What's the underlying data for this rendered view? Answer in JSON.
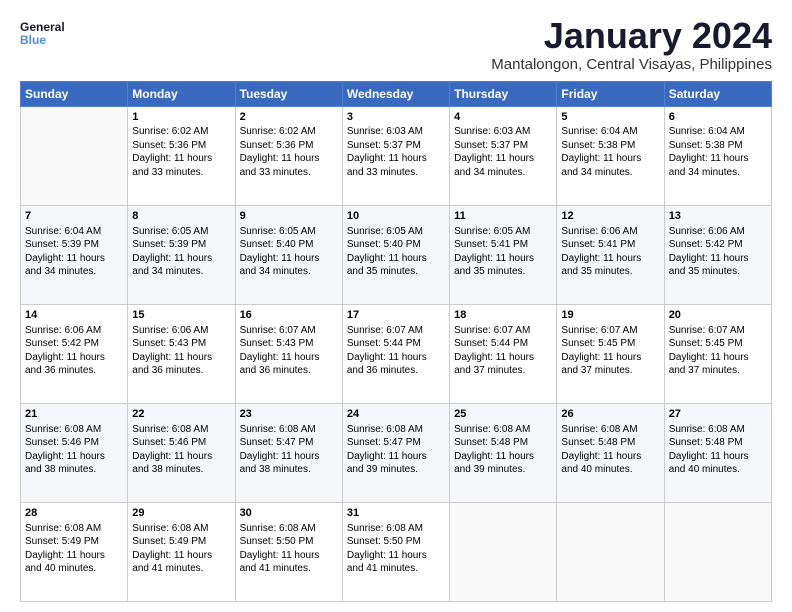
{
  "header": {
    "logo_general": "General",
    "logo_blue": "Blue",
    "month_title": "January 2024",
    "location": "Mantalongon, Central Visayas, Philippines"
  },
  "calendar": {
    "days_of_week": [
      "Sunday",
      "Monday",
      "Tuesday",
      "Wednesday",
      "Thursday",
      "Friday",
      "Saturday"
    ],
    "weeks": [
      [
        {
          "day": "",
          "content": ""
        },
        {
          "day": "1",
          "content": "Sunrise: 6:02 AM\nSunset: 5:36 PM\nDaylight: 11 hours\nand 33 minutes."
        },
        {
          "day": "2",
          "content": "Sunrise: 6:02 AM\nSunset: 5:36 PM\nDaylight: 11 hours\nand 33 minutes."
        },
        {
          "day": "3",
          "content": "Sunrise: 6:03 AM\nSunset: 5:37 PM\nDaylight: 11 hours\nand 33 minutes."
        },
        {
          "day": "4",
          "content": "Sunrise: 6:03 AM\nSunset: 5:37 PM\nDaylight: 11 hours\nand 34 minutes."
        },
        {
          "day": "5",
          "content": "Sunrise: 6:04 AM\nSunset: 5:38 PM\nDaylight: 11 hours\nand 34 minutes."
        },
        {
          "day": "6",
          "content": "Sunrise: 6:04 AM\nSunset: 5:38 PM\nDaylight: 11 hours\nand 34 minutes."
        }
      ],
      [
        {
          "day": "7",
          "content": "Sunrise: 6:04 AM\nSunset: 5:39 PM\nDaylight: 11 hours\nand 34 minutes."
        },
        {
          "day": "8",
          "content": "Sunrise: 6:05 AM\nSunset: 5:39 PM\nDaylight: 11 hours\nand 34 minutes."
        },
        {
          "day": "9",
          "content": "Sunrise: 6:05 AM\nSunset: 5:40 PM\nDaylight: 11 hours\nand 34 minutes."
        },
        {
          "day": "10",
          "content": "Sunrise: 6:05 AM\nSunset: 5:40 PM\nDaylight: 11 hours\nand 35 minutes."
        },
        {
          "day": "11",
          "content": "Sunrise: 6:05 AM\nSunset: 5:41 PM\nDaylight: 11 hours\nand 35 minutes."
        },
        {
          "day": "12",
          "content": "Sunrise: 6:06 AM\nSunset: 5:41 PM\nDaylight: 11 hours\nand 35 minutes."
        },
        {
          "day": "13",
          "content": "Sunrise: 6:06 AM\nSunset: 5:42 PM\nDaylight: 11 hours\nand 35 minutes."
        }
      ],
      [
        {
          "day": "14",
          "content": "Sunrise: 6:06 AM\nSunset: 5:42 PM\nDaylight: 11 hours\nand 36 minutes."
        },
        {
          "day": "15",
          "content": "Sunrise: 6:06 AM\nSunset: 5:43 PM\nDaylight: 11 hours\nand 36 minutes."
        },
        {
          "day": "16",
          "content": "Sunrise: 6:07 AM\nSunset: 5:43 PM\nDaylight: 11 hours\nand 36 minutes."
        },
        {
          "day": "17",
          "content": "Sunrise: 6:07 AM\nSunset: 5:44 PM\nDaylight: 11 hours\nand 36 minutes."
        },
        {
          "day": "18",
          "content": "Sunrise: 6:07 AM\nSunset: 5:44 PM\nDaylight: 11 hours\nand 37 minutes."
        },
        {
          "day": "19",
          "content": "Sunrise: 6:07 AM\nSunset: 5:45 PM\nDaylight: 11 hours\nand 37 minutes."
        },
        {
          "day": "20",
          "content": "Sunrise: 6:07 AM\nSunset: 5:45 PM\nDaylight: 11 hours\nand 37 minutes."
        }
      ],
      [
        {
          "day": "21",
          "content": "Sunrise: 6:08 AM\nSunset: 5:46 PM\nDaylight: 11 hours\nand 38 minutes."
        },
        {
          "day": "22",
          "content": "Sunrise: 6:08 AM\nSunset: 5:46 PM\nDaylight: 11 hours\nand 38 minutes."
        },
        {
          "day": "23",
          "content": "Sunrise: 6:08 AM\nSunset: 5:47 PM\nDaylight: 11 hours\nand 38 minutes."
        },
        {
          "day": "24",
          "content": "Sunrise: 6:08 AM\nSunset: 5:47 PM\nDaylight: 11 hours\nand 39 minutes."
        },
        {
          "day": "25",
          "content": "Sunrise: 6:08 AM\nSunset: 5:48 PM\nDaylight: 11 hours\nand 39 minutes."
        },
        {
          "day": "26",
          "content": "Sunrise: 6:08 AM\nSunset: 5:48 PM\nDaylight: 11 hours\nand 40 minutes."
        },
        {
          "day": "27",
          "content": "Sunrise: 6:08 AM\nSunset: 5:48 PM\nDaylight: 11 hours\nand 40 minutes."
        }
      ],
      [
        {
          "day": "28",
          "content": "Sunrise: 6:08 AM\nSunset: 5:49 PM\nDaylight: 11 hours\nand 40 minutes."
        },
        {
          "day": "29",
          "content": "Sunrise: 6:08 AM\nSunset: 5:49 PM\nDaylight: 11 hours\nand 41 minutes."
        },
        {
          "day": "30",
          "content": "Sunrise: 6:08 AM\nSunset: 5:50 PM\nDaylight: 11 hours\nand 41 minutes."
        },
        {
          "day": "31",
          "content": "Sunrise: 6:08 AM\nSunset: 5:50 PM\nDaylight: 11 hours\nand 41 minutes."
        },
        {
          "day": "",
          "content": ""
        },
        {
          "day": "",
          "content": ""
        },
        {
          "day": "",
          "content": ""
        }
      ]
    ]
  }
}
